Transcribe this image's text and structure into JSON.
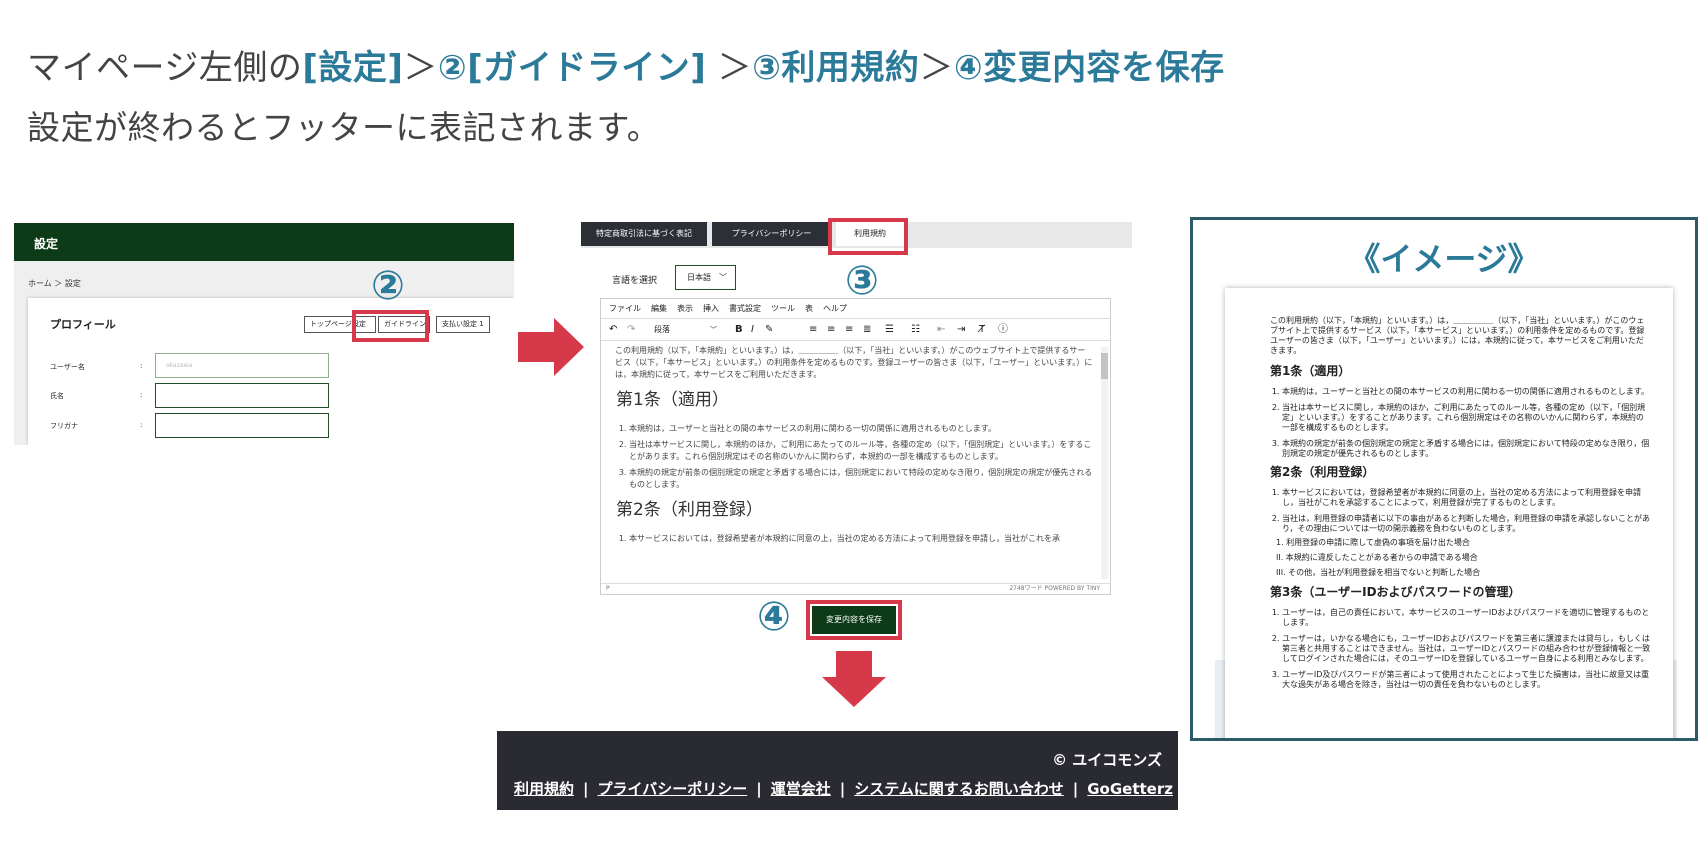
{
  "heading": {
    "prefix": "マイページ左側の",
    "step1": "[設定]",
    "sep1": "＞",
    "step2": "②[ガイドライン]",
    "sep2": "＞",
    "step3": "③利用規約",
    "sep3": "＞",
    "step4": "④変更内容を保存",
    "subtitle": "設定が終わるとフッターに表記されます。"
  },
  "colors": {
    "accent": "#2c7a99",
    "highlight_red": "#d63a4a",
    "dark_green": "#0d3b17",
    "footer_bg": "#2a2a33"
  },
  "settings_panel": {
    "header_title": "設定",
    "breadcrumb": "ホーム ＞ 設定",
    "badge": "②",
    "card_title": "プロフィール",
    "buttons": [
      "トップページ設定",
      "ガイドライン",
      "支払い設定 1"
    ],
    "fields": [
      {
        "label": "ユーザー名",
        "colon": ":",
        "value": "okazawa"
      },
      {
        "label": "氏名",
        "colon": ":",
        "value": ""
      },
      {
        "label": "フリガナ",
        "colon": ":",
        "value": ""
      }
    ]
  },
  "editor_panel": {
    "tabs": [
      "特定商取引法に基づく表記",
      "プライバシーポリシー",
      "利用規約"
    ],
    "badge": "③",
    "language_label": "言語を選択",
    "language_value": "日本語",
    "menu": [
      "ファイル",
      "編集",
      "表示",
      "挿入",
      "書式設定",
      "ツール",
      "表",
      "ヘルプ"
    ],
    "block_format": "段落",
    "toolbar_icons": [
      "undo-icon",
      "redo-icon",
      "bold-icon",
      "italic-icon",
      "highlight-icon",
      "align-left-icon",
      "align-center-icon",
      "align-right-icon",
      "justify-icon",
      "bullet-list-icon",
      "numbered-list-icon",
      "outdent-icon",
      "indent-icon",
      "clear-format-icon",
      "help-icon"
    ],
    "intro": "この利用規約（以下，「本規約」といいます。）は，＿＿＿＿＿（以下，「当社」といいます。）がこのウェブサイト上で提供するサービス（以下，「本サービス」といいます。）の利用条件を定めるものです。登録ユーザーの皆さま（以下，「ユーザー」といいます。）には，本規約に従って，本サービスをご利用いただきます。",
    "article1_title": "第1条（適用）",
    "article1_items": [
      "本規約は，ユーザーと当社との間の本サービスの利用に関わる一切の関係に適用されるものとします。",
      "当社は本サービスに関し，本規約のほか，ご利用にあたってのルール等，各種の定め（以下，「個別規定」といいます。）をすることがあります。これら個別規定はその名称のいかんに関わらず，本規約の一部を構成するものとします。",
      "本規約の規定が前条の個別規定の規定と矛盾する場合には，個別規定において特段の定めなき限り，個別規定の規定が優先されるものとします。"
    ],
    "article2_title": "第2条（利用登録）",
    "article2_items": [
      "本サービスにおいては，登録希望者が本規約に同意の上，当社の定める方法によって利用登録を申請し，当社がこれを承"
    ],
    "status_left": "P",
    "status_right": "2748ワード  POWERED BY TINY",
    "save_badge": "④",
    "save_button": "変更内容を保存"
  },
  "footer": {
    "copyright": "© ユイコモンズ",
    "links": [
      "利用規約",
      "プライバシーポリシー",
      "運営会社",
      "システムに関するお問い合わせ",
      "GoGetterz"
    ],
    "separator": "|"
  },
  "preview_panel": {
    "title": "《イメージ》",
    "intro": "この利用規約（以下，「本規約」といいます。）は，＿＿＿＿＿（以下，「当社」といいます。）がこのウェブサイト上で提供するサービス（以下，「本サービス」といいます。）の利用条件を定めるものです。登録ユーザーの皆さま（以下，「ユーザー」といいます。）には，本規約に従って，本サービスをご利用いただきます。",
    "article1_title": "第1条（適用）",
    "article1_items": [
      "本規約は，ユーザーと当社との間の本サービスの利用に関わる一切の関係に適用されるものとします。",
      "当社は本サービスに関し，本規約のほか，ご利用にあたってのルール等，各種の定め（以下，「個別規定」といいます。）をすることがあります。これら個別規定はその名称のいかんに関わらず，本規約の一部を構成するものとします。",
      "本規約の規定が前条の個別規定の規定と矛盾する場合には，個別規定において特段の定めなき限り，個別規定の規定が優先されるものとします。"
    ],
    "article2_title": "第2条（利用登録）",
    "article2_items": [
      "本サービスにおいては，登録希望者が本規約に同意の上，当社の定める方法によって利用登録を申請し，当社がこれを承認することによって，利用登録が完了するものとします。",
      "当社は，利用登録の申請者に以下の事由があると判断した場合，利用登録の申請を承認しないことがあり，その理由については一切の開示義務を負わないものとします。"
    ],
    "article2_subitems": [
      "1. 利用登録の申請に際して虚偽の事項を届け出た場合",
      "II. 本規約に違反したことがある者からの申請である場合",
      "III. その他，当社が利用登録を相当でないと判断した場合"
    ],
    "article3_title": "第3条（ユーザーIDおよびパスワードの管理）",
    "article3_items": [
      "ユーザーは，自己の責任において，本サービスのユーザーIDおよびパスワードを適切に管理するものとします。",
      "ユーザーは，いかなる場合にも，ユーザーIDおよびパスワードを第三者に譲渡または貸与し，もしくは第三者と共用することはできません。当社は，ユーザーIDとパスワードの組み合わせが登録情報と一致してログインされた場合には，そのユーザーIDを登録しているユーザー自身による利用とみなします。",
      "ユーザーID及びパスワードが第三者によって使用されたことによって生じた損害は，当社に故意又は重大な過失がある場合を除き，当社は一切の責任を負わないものとします。"
    ]
  }
}
